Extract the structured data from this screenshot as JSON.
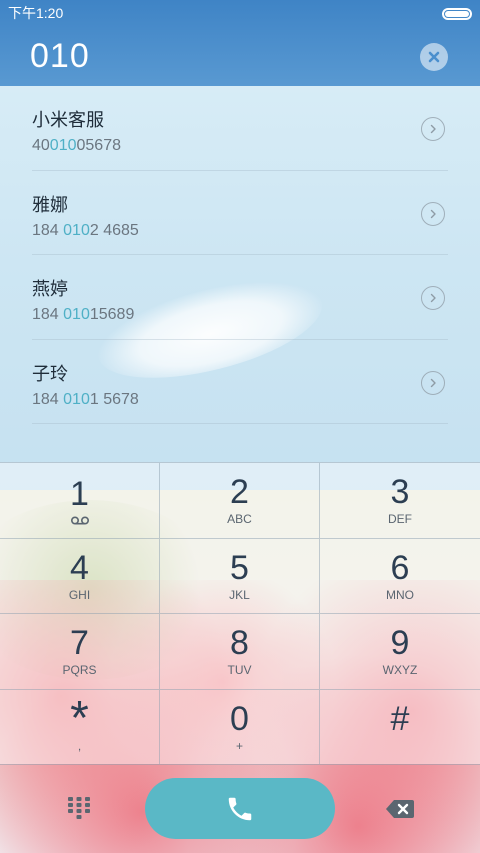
{
  "status_bar": {
    "time": "下午1:20"
  },
  "dial": {
    "number": "010"
  },
  "contacts": [
    {
      "name": "小米客服",
      "number_pre": "40",
      "number_match": "010",
      "number_post": "05678"
    },
    {
      "name": "雅娜",
      "number_pre": "184 ",
      "number_match": "010",
      "number_post": "2 4685"
    },
    {
      "name": "燕婷",
      "number_pre": "184 ",
      "number_match": "010",
      "number_post": "15689"
    },
    {
      "name": "子玲",
      "number_pre": "184 ",
      "number_match": "010",
      "number_post": "1 5678"
    }
  ],
  "keypad": [
    {
      "digit": "1",
      "letters": ""
    },
    {
      "digit": "2",
      "letters": "ABC"
    },
    {
      "digit": "3",
      "letters": "DEF"
    },
    {
      "digit": "4",
      "letters": "GHI"
    },
    {
      "digit": "5",
      "letters": "JKL"
    },
    {
      "digit": "6",
      "letters": "MNO"
    },
    {
      "digit": "7",
      "letters": "PQRS"
    },
    {
      "digit": "8",
      "letters": "TUV"
    },
    {
      "digit": "9",
      "letters": "WXYZ"
    },
    {
      "digit": "*",
      "letters": ","
    },
    {
      "digit": "0",
      "letters": "+"
    },
    {
      "digit": "#",
      "letters": ""
    }
  ],
  "icons": {
    "clear": "close-icon",
    "detail": "chevron-right-icon",
    "voicemail": "voicemail-icon",
    "dialpad": "dialpad-icon",
    "call": "phone-icon",
    "backspace": "backspace-icon"
  },
  "colors": {
    "accent": "#5ab8c6",
    "match_highlight": "#4fb0c6",
    "header": "#4a8fcd"
  }
}
